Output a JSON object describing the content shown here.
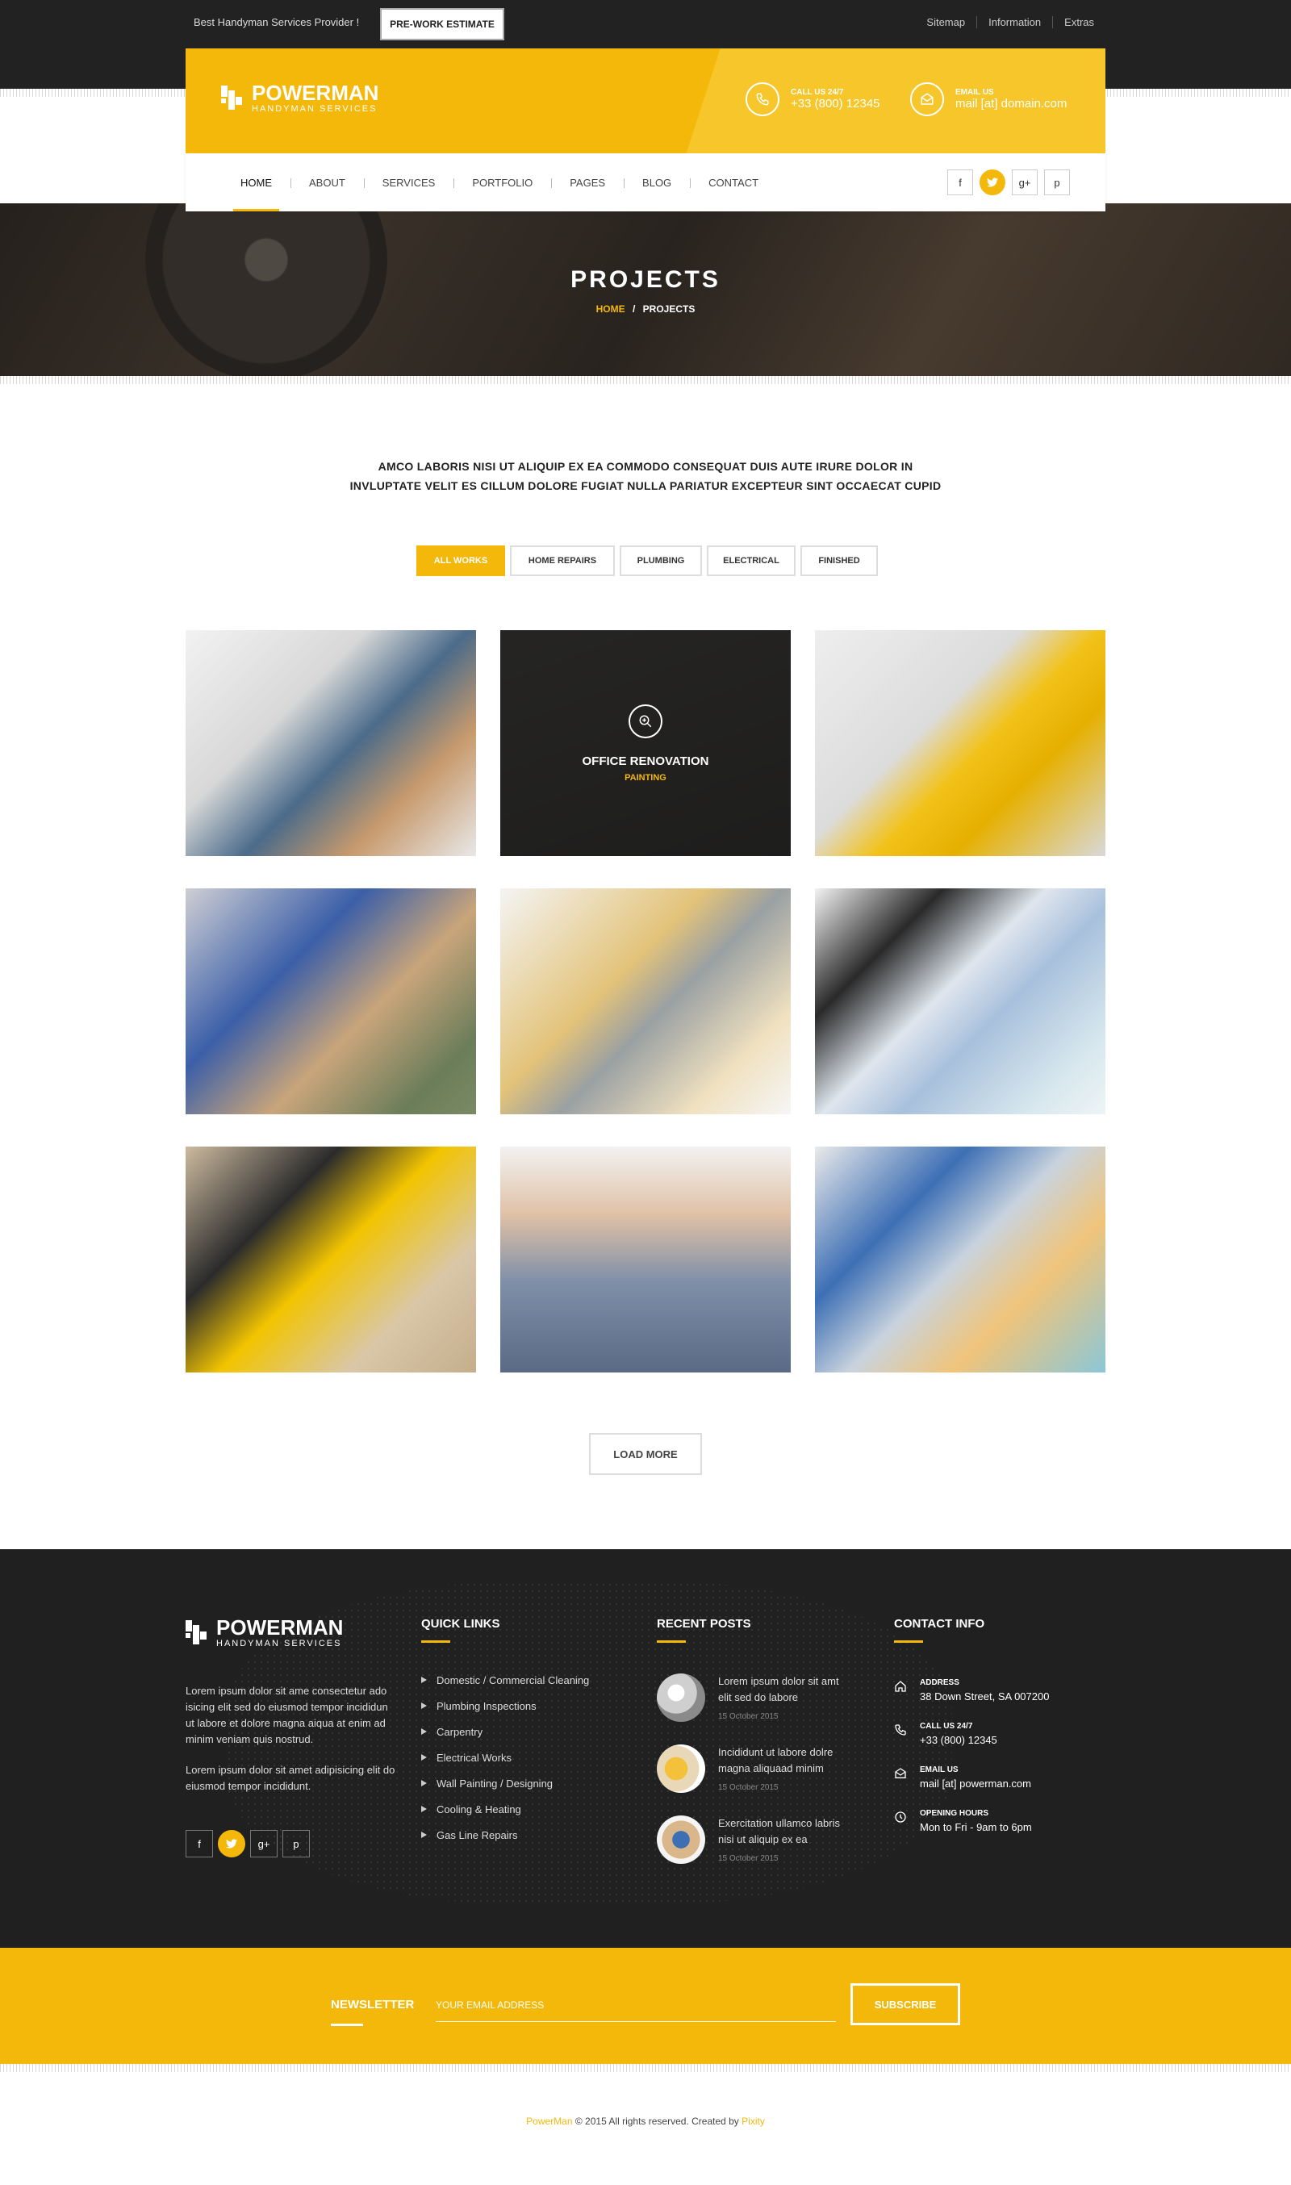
{
  "topbar": {
    "tagline": "Best Handyman Services Provider !",
    "estimate_label": "PRE-WORK ESTIMATE",
    "links": [
      "Sitemap",
      "Information",
      "Extras"
    ]
  },
  "header": {
    "brand": "POWERMAN",
    "brand_sub": "HANDYMAN SERVICES",
    "call_label": "CALL US 24/7",
    "call_value": "+33 (800) 12345",
    "email_label": "EMAIL US",
    "email_value": "mail [at] domain.com"
  },
  "nav": {
    "items": [
      "HOME",
      "ABOUT",
      "SERVICES",
      "PORTFOLIO",
      "PAGES",
      "BLOG",
      "CONTACT"
    ],
    "active": "HOME",
    "social": [
      "f",
      "t",
      "g+",
      "p"
    ]
  },
  "banner": {
    "title": "PROJECTS",
    "crumb_home": "HOME",
    "crumb_sep": "/",
    "crumb_current": "PROJECTS"
  },
  "intro": {
    "line1": "AMCO LABORIS NISI UT ALIQUIP EX EA COMMODO CONSEQUAT DUIS AUTE IRURE DOLOR IN",
    "line2": "INVLUPTATE VELIT ES CILLUM DOLORE FUGIAT NULLA PARIATUR EXCEPTEUR SINT OCCAECAT CUPID"
  },
  "filters": [
    "ALL WORKS",
    "HOME REPAIRS",
    "PLUMBING",
    "ELECTRICAL",
    "FINISHED"
  ],
  "gallery": {
    "hover_title": "OFFICE RENOVATION",
    "hover_category": "PAINTING"
  },
  "load_more": "LOAD MORE",
  "footer": {
    "brand": "POWERMAN",
    "brand_sub": "HANDYMAN SERVICES",
    "about_p1": "Lorem ipsum dolor sit ame consectetur ado isicing elit sed do eiusmod tempor incididun ut labore et dolore magna aiqua at enim ad minim veniam quis nostrud.",
    "about_p2": "Lorem ipsum dolor sit amet adipisicing elit do eiusmod tempor incididunt.",
    "quick_links_title": "QUICK LINKS",
    "quick_links": [
      "Domestic / Commercial Cleaning",
      "Plumbing Inspections",
      "Carpentry",
      "Electrical Works",
      "Wall Painting / Designing",
      "Cooling & Heating",
      "Gas Line Repairs"
    ],
    "recent_posts_title": "RECENT POSTS",
    "posts": [
      {
        "title": "Lorem ipsum dolor sit amt elit sed do labore",
        "date": "15 October 2015"
      },
      {
        "title": "Incididunt ut labore dolre magna aliquaad minim",
        "date": "15 October 2015"
      },
      {
        "title": "Exercitation ullamco labris nisi ut aliquip ex ea",
        "date": "15 October 2015"
      }
    ],
    "contact_title": "CONTACT INFO",
    "contact": [
      {
        "label": "ADDRESS",
        "value": "38 Down Street, SA 007200"
      },
      {
        "label": "CALL US 24/7",
        "value": "+33 (800) 12345"
      },
      {
        "label": "EMAIL US",
        "value": "mail [at] powerman.com"
      },
      {
        "label": "OPENING HOURS",
        "value": "Mon to Fri  -  9am to 6pm"
      }
    ]
  },
  "newsletter": {
    "label": "NEWSLETTER",
    "placeholder": "YOUR EMAIL ADDRESS",
    "button": "SUBSCRIBE"
  },
  "copyright": {
    "brand": "PowerMan",
    "text": " © 2015  All rights reserved. Created by ",
    "author": "Pixity"
  },
  "colors": {
    "accent": "#f3b80a",
    "dark": "#222222",
    "footer": "#202020"
  }
}
